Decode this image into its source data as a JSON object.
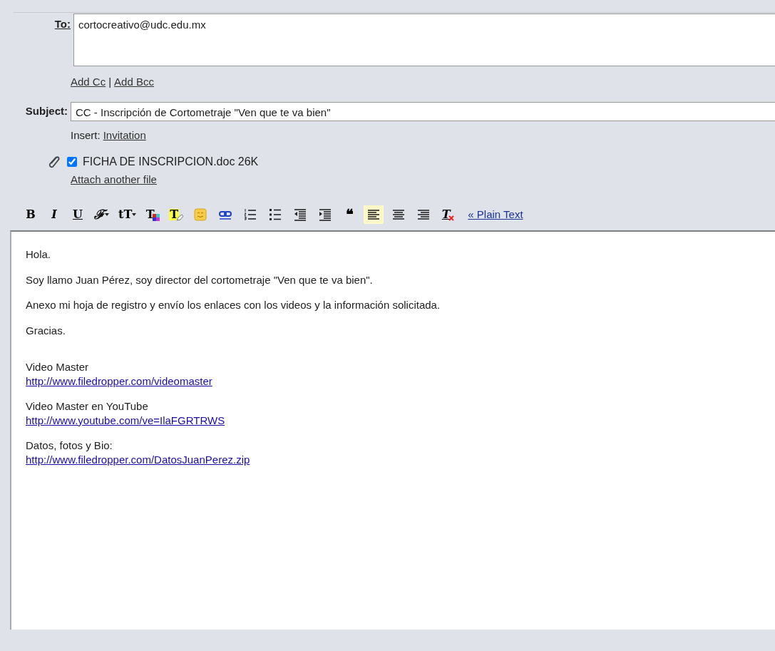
{
  "to": {
    "label": "To:",
    "value": "cortocreativo@udc.edu.mx"
  },
  "cc_links": [
    {
      "text": "Add Cc"
    },
    {
      "text": "Add Bcc"
    }
  ],
  "cc_separator": "|",
  "subject": {
    "label": "Subject:",
    "value": "CC - Inscripción de Cortometraje \"Ven que te va bien\""
  },
  "insert": {
    "label": "Insert:",
    "link": "Invitation"
  },
  "attachments": [
    {
      "name": "FICHA DE INSCRIPCION.doc 26K",
      "checked": true
    }
  ],
  "attach_another": "Attach another file",
  "toolbar": [
    {
      "kind": "bold",
      "label": "B",
      "selected": false
    },
    {
      "kind": "italic",
      "label": "I",
      "selected": false
    },
    {
      "kind": "underline",
      "label": "U",
      "selected": false
    },
    {
      "kind": "font",
      "label": "ℱ",
      "selected": false
    },
    {
      "kind": "size",
      "label": "tT",
      "selected": false
    },
    {
      "kind": "textcolor",
      "label": "T",
      "selected": false
    },
    {
      "kind": "highlight",
      "label": "T",
      "selected": false
    },
    {
      "kind": "emoticon",
      "selected": false
    },
    {
      "kind": "link",
      "selected": false
    },
    {
      "kind": "numbered",
      "selected": false
    },
    {
      "kind": "bulleted",
      "selected": false
    },
    {
      "kind": "outdent",
      "selected": false
    },
    {
      "kind": "indent",
      "selected": false
    },
    {
      "kind": "quote",
      "label": "❝",
      "selected": false
    },
    {
      "kind": "alignleft",
      "selected": true
    },
    {
      "kind": "aligncenter",
      "selected": false
    },
    {
      "kind": "alignright",
      "selected": false
    },
    {
      "kind": "removeformat",
      "label": "T",
      "selected": false
    }
  ],
  "plain_text": "« Plain Text",
  "body": [
    [
      {
        "kind": "text",
        "text": "Hola."
      }
    ],
    [
      {
        "kind": "text",
        "text": "Soy llamo Juan Pérez, soy director del cortometraje \"Ven que te va bien\"."
      }
    ],
    [
      {
        "kind": "text",
        "text": "Anexo mi hoja de registro y envío los enlaces con los videos y la información solicitada."
      }
    ],
    [
      {
        "kind": "text",
        "text": "Gracias."
      }
    ],
    [
      {
        "kind": "gap"
      }
    ],
    [
      {
        "kind": "text",
        "text": "Video Master"
      },
      {
        "kind": "link",
        "text": "http://www.filedropper.com/videomaster"
      }
    ],
    [
      {
        "kind": "text",
        "text": "Video Master en YouTube"
      },
      {
        "kind": "link",
        "text": "http://www.youtube.com/ve=IlaFGRTRWS"
      }
    ],
    [
      {
        "kind": "text",
        "text": "Datos, fotos y Bio:"
      },
      {
        "kind": "link",
        "text": "http://www.filedropper.com/DatosJuanPerez.zip"
      }
    ]
  ]
}
